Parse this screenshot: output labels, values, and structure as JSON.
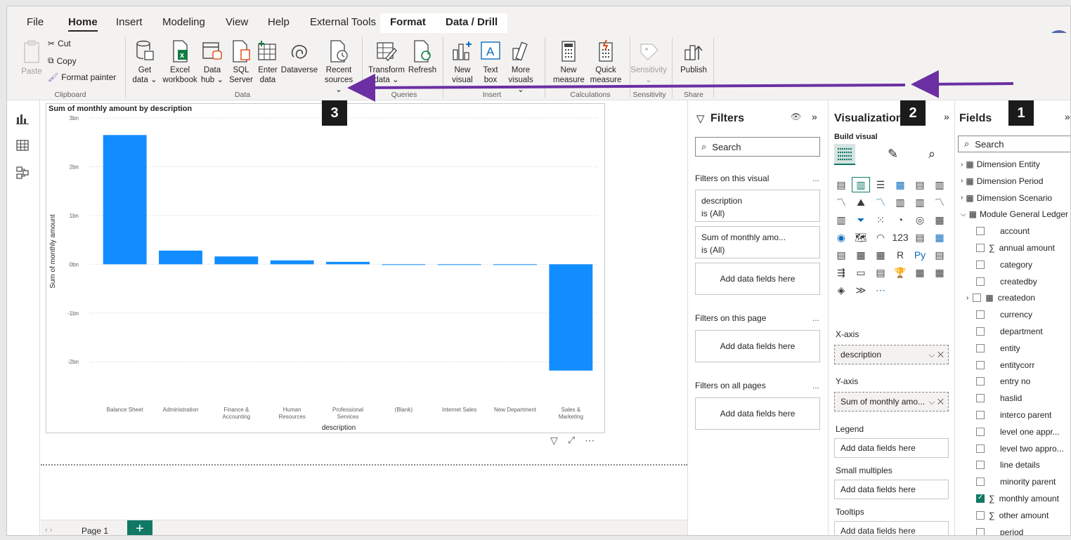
{
  "ribbon_tabs": [
    "File",
    "Home",
    "Insert",
    "Modeling",
    "View",
    "Help",
    "External Tools",
    "Format",
    "Data / Drill"
  ],
  "clipboard": {
    "paste": "Paste",
    "cut": "Cut",
    "copy": "Copy",
    "format_painter": "Format painter",
    "group": "Clipboard"
  },
  "data_group": {
    "get_data": [
      "Get",
      "data ⌄"
    ],
    "excel": [
      "Excel",
      "workbook"
    ],
    "data_hub": [
      "Data",
      "hub ⌄"
    ],
    "sql": [
      "SQL",
      "Server"
    ],
    "enter_data": [
      "Enter",
      "data"
    ],
    "dataverse": "Dataverse",
    "recent_sources": [
      "Recent",
      "sources ⌄"
    ],
    "group": "Data"
  },
  "queries_group": {
    "transform": [
      "Transform",
      "data ⌄"
    ],
    "refresh": "Refresh",
    "group": "Queries"
  },
  "insert_group": {
    "new_visual": [
      "New",
      "visual"
    ],
    "text_box": [
      "Text",
      "box"
    ],
    "more_visuals": [
      "More",
      "visuals ⌄"
    ],
    "group": "Insert"
  },
  "calc_group": {
    "new_measure": [
      "New",
      "measure"
    ],
    "quick_measure": [
      "Quick",
      "measure"
    ],
    "group": "Calculations"
  },
  "sensitivity_group": {
    "sensitivity": [
      "Sensitivity",
      "⌄"
    ],
    "group": "Sensitivity"
  },
  "share_group": {
    "publish": "Publish",
    "group": "Share"
  },
  "badges": [
    "1",
    "2",
    "3"
  ],
  "visual": {
    "title": "Sum of monthly amount by description"
  },
  "chart_data": {
    "type": "bar",
    "title": "Sum of monthly amount by description",
    "xlabel": "description",
    "ylabel": "Sum of monthly amount",
    "categories": [
      "Balance Sheet",
      "Administration",
      "Finance & Accounting",
      "Human Resources",
      "Professional Services",
      "(Blank)",
      "Internet Sales",
      "New Department",
      "Sales & Marketing"
    ],
    "values": [
      2.65,
      0.28,
      0.16,
      0.08,
      0.05,
      0.0,
      0.0,
      0.0,
      -2.18
    ],
    "y_ticks": [
      "3bn",
      "2bn",
      "1bn",
      "0bn",
      "-1bn",
      "-2bn"
    ],
    "ylim": [
      -2.4,
      3.0
    ],
    "unit": "bn",
    "grid": true,
    "bar_color": "#118dff"
  },
  "page_bar": {
    "page_label": "Page 1",
    "add": "+"
  },
  "filters_pane": {
    "title": "Filters",
    "search_placeholder": "Search",
    "on_visual": "Filters on this visual",
    "card1_name": "description",
    "card1_state": "is (All)",
    "card2_name": "Sum of monthly amo...",
    "card2_state": "is (All)",
    "add_fields": "Add data fields here",
    "on_page": "Filters on this page",
    "on_all": "Filters on all pages",
    "ellipsis": "..."
  },
  "viz_pane": {
    "title": "Visualizations",
    "build_visual": "Build visual",
    "x_axis": "X-axis",
    "x_value": "description",
    "y_axis": "Y-axis",
    "y_value": "Sum of monthly amo...",
    "legend": "Legend",
    "small_multiples": "Small multiples",
    "tooltips": "Tooltips",
    "add_fields": "Add data fields here",
    "icon_glyphs": [
      "▤",
      "▥",
      "☰",
      "▦",
      "▤",
      "▥",
      "〽",
      "⛰",
      "〽",
      "▥",
      "▥",
      "〽",
      "▥",
      "⏷",
      "⁙",
      "◔",
      "◎",
      "▦",
      "◉",
      "🗺",
      "◠",
      "123",
      "▤",
      "▦",
      "▤",
      "▦",
      "▦",
      "R",
      "Py",
      "▤",
      "⇶",
      "▭",
      "▤",
      "🏆",
      "▦",
      "▦",
      "◈",
      "≫",
      "⋯"
    ]
  },
  "fields_pane": {
    "title": "Fields",
    "search_placeholder": "Search",
    "tables": [
      "Dimension Entity",
      "Dimension Period",
      "Dimension Scenario",
      "Module General Ledger"
    ],
    "fields": [
      {
        "name": "account",
        "sigma": false,
        "checked": false
      },
      {
        "name": "annual amount",
        "sigma": true,
        "checked": false
      },
      {
        "name": "category",
        "sigma": false,
        "checked": false
      },
      {
        "name": "createdby",
        "sigma": false,
        "checked": false
      },
      {
        "name": "createdon",
        "sigma": false,
        "checked": false,
        "date": true
      },
      {
        "name": "currency",
        "sigma": false,
        "checked": false
      },
      {
        "name": "department",
        "sigma": false,
        "checked": false
      },
      {
        "name": "entity",
        "sigma": false,
        "checked": false
      },
      {
        "name": "entitycorr",
        "sigma": false,
        "checked": false
      },
      {
        "name": "entry no",
        "sigma": false,
        "checked": false
      },
      {
        "name": "haslid",
        "sigma": false,
        "checked": false
      },
      {
        "name": "interco parent",
        "sigma": false,
        "checked": false
      },
      {
        "name": "level one appr...",
        "sigma": false,
        "checked": false
      },
      {
        "name": "level two appro...",
        "sigma": false,
        "checked": false
      },
      {
        "name": "line details",
        "sigma": false,
        "checked": false
      },
      {
        "name": "minority parent",
        "sigma": false,
        "checked": false
      },
      {
        "name": "monthly amount",
        "sigma": true,
        "checked": true
      },
      {
        "name": "other amount",
        "sigma": true,
        "checked": false
      },
      {
        "name": "period",
        "sigma": false,
        "checked": false
      }
    ]
  },
  "colors": {
    "accent": "#117865",
    "bar": "#118dff",
    "arrow": "#6b2fa3"
  }
}
